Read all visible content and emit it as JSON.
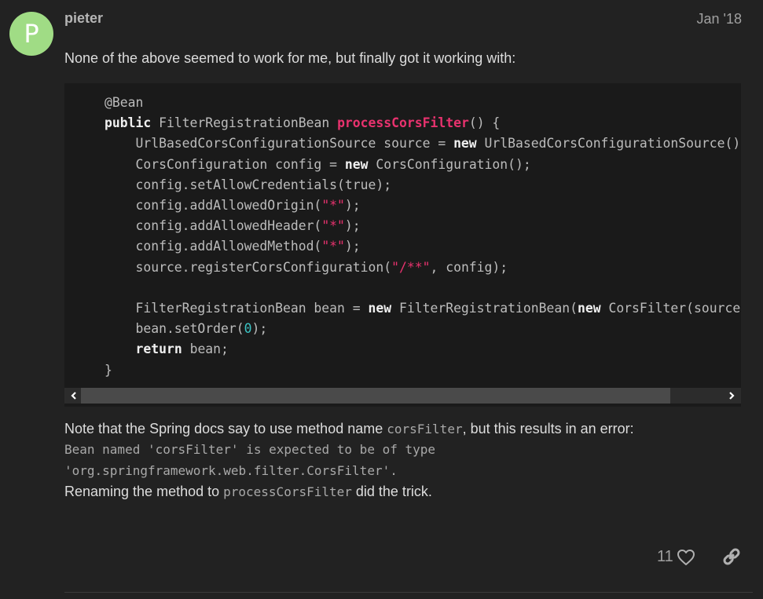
{
  "post": {
    "avatar_letter": "P",
    "author": "pieter",
    "date": "Jan '18",
    "intro": "None of the above seemed to work for me, but finally got it working with:",
    "note_prefix": "Note that the Spring docs say to use method name ",
    "note_code": "corsFilter",
    "note_suffix": ", but this results in an error:",
    "error_line1": "Bean named 'corsFilter' is expected to be of type",
    "error_line2": "'org.springframework.web.filter.CorsFilter'.",
    "rename_prefix": "Renaming the method to ",
    "rename_code": "processCorsFilter",
    "rename_suffix": " did the trick.",
    "likes": "11"
  },
  "code": {
    "l1": "@Bean",
    "l2_kw": "public",
    "l2_type": " FilterRegistrationBean ",
    "l2_fn": "processCorsFilter",
    "l2_rest": "() {",
    "l3_a": "    UrlBasedCorsConfigurationSource source = ",
    "l3_kw": "new",
    "l3_b": " UrlBasedCorsConfigurationSource();",
    "l4_a": "    CorsConfiguration config = ",
    "l4_kw": "new",
    "l4_b": " CorsConfiguration();",
    "l5": "    config.setAllowCredentials(true);",
    "l6_a": "    config.addAllowedOrigin(",
    "l6_s": "\"*\"",
    "l6_b": ");",
    "l7_a": "    config.addAllowedHeader(",
    "l7_s": "\"*\"",
    "l7_b": ");",
    "l8_a": "    config.addAllowedMethod(",
    "l8_s": "\"*\"",
    "l8_b": ");",
    "l9_a": "    source.registerCorsConfiguration(",
    "l9_s": "\"/**\"",
    "l9_b": ", config);",
    "l11_a": "    FilterRegistrationBean bean = ",
    "l11_kw": "new",
    "l11_b": " FilterRegistrationBean(",
    "l11_kw2": "new",
    "l11_c": " CorsFilter(source));",
    "l12_a": "    bean.setOrder(",
    "l12_n": "0",
    "l12_b": ");",
    "l13_kw": "return",
    "l13_b": " bean;",
    "l14": "}"
  },
  "icons": {
    "like": "heart-icon",
    "share": "link-icon",
    "scroll_left": "chevron-left-icon",
    "scroll_right": "chevron-right-icon"
  }
}
